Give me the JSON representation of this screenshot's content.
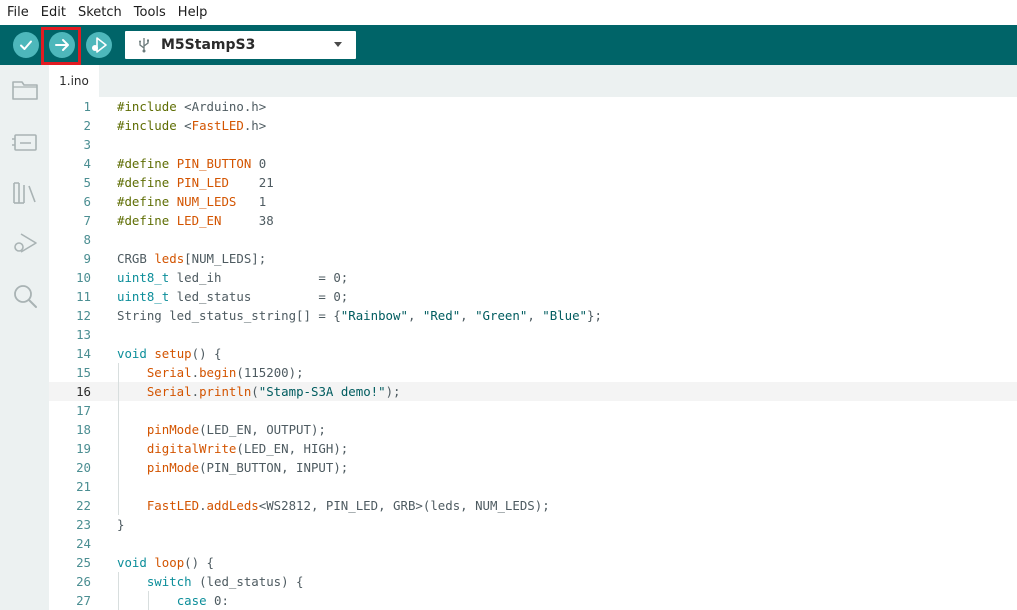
{
  "menu": [
    "File",
    "Edit",
    "Sketch",
    "Tools",
    "Help"
  ],
  "toolbar": {
    "buttons": [
      {
        "name": "verify-button",
        "icon": "check-icon"
      },
      {
        "name": "upload-button",
        "icon": "arrow-right-icon"
      },
      {
        "name": "debug-button",
        "icon": "debug-icon"
      }
    ],
    "board_name": "M5StampS3"
  },
  "sidebar": {
    "icons": [
      "folder-icon",
      "board-manager-icon",
      "library-icon",
      "debug-icon",
      "search-icon"
    ]
  },
  "tabs": [
    {
      "label": "1.ino",
      "active": true
    }
  ],
  "editor": {
    "current_line": 16,
    "lines": [
      {
        "n": "1",
        "text": "#include <Arduino.h>"
      },
      {
        "n": "2",
        "text": "#include <FastLED.h>"
      },
      {
        "n": "3",
        "text": ""
      },
      {
        "n": "4",
        "text": "#define PIN_BUTTON 0"
      },
      {
        "n": "5",
        "text": "#define PIN_LED    21"
      },
      {
        "n": "6",
        "text": "#define NUM_LEDS   1"
      },
      {
        "n": "7",
        "text": "#define LED_EN     38"
      },
      {
        "n": "8",
        "text": ""
      },
      {
        "n": "9",
        "text": "CRGB leds[NUM_LEDS];"
      },
      {
        "n": "10",
        "text": "uint8_t led_ih             = 0;"
      },
      {
        "n": "11",
        "text": "uint8_t led_status         = 0;"
      },
      {
        "n": "12",
        "text": "String led_status_string[] = {\"Rainbow\", \"Red\", \"Green\", \"Blue\"};"
      },
      {
        "n": "13",
        "text": ""
      },
      {
        "n": "14",
        "text": "void setup() {"
      },
      {
        "n": "15",
        "text": "    Serial.begin(115200);"
      },
      {
        "n": "16",
        "text": "    Serial.println(\"Stamp-S3A demo!\");"
      },
      {
        "n": "17",
        "text": ""
      },
      {
        "n": "18",
        "text": "    pinMode(LED_EN, OUTPUT);"
      },
      {
        "n": "19",
        "text": "    digitalWrite(LED_EN, HIGH);"
      },
      {
        "n": "20",
        "text": "    pinMode(PIN_BUTTON, INPUT);"
      },
      {
        "n": "21",
        "text": ""
      },
      {
        "n": "22",
        "text": "    FastLED.addLeds<WS2812, PIN_LED, GRB>(leds, NUM_LEDS);"
      },
      {
        "n": "23",
        "text": "}"
      },
      {
        "n": "24",
        "text": ""
      },
      {
        "n": "25",
        "text": "void loop() {"
      },
      {
        "n": "26",
        "text": "    switch (led_status) {"
      },
      {
        "n": "27",
        "text": "        case 0:"
      }
    ]
  },
  "colors": {
    "toolbar_bg": "#006468",
    "button_bg": "#4db7bb",
    "sidebar_bg": "#ecf1f1",
    "highlight_border": "#e11b22",
    "keyword": "#0c8e9a",
    "preprocessor": "#5e6d03",
    "function": "#d35400",
    "string": "#005c5f"
  }
}
